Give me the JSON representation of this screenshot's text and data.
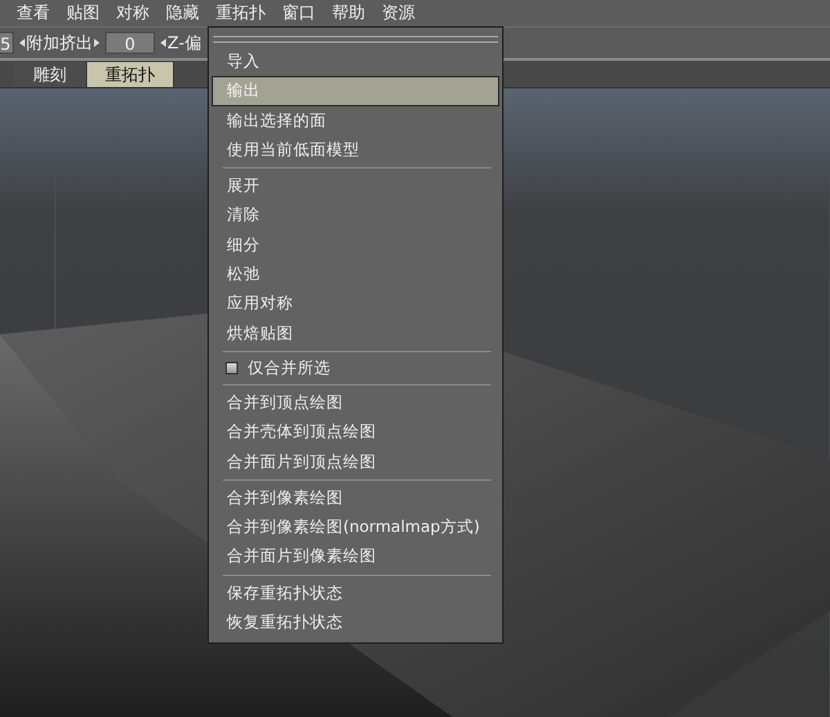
{
  "menu_bar": [
    {
      "label": "查看"
    },
    {
      "label": "贴图"
    },
    {
      "label": "对称"
    },
    {
      "label": "隐藏"
    },
    {
      "label": "重拓扑"
    },
    {
      "label": "窗口"
    },
    {
      "label": "帮助"
    },
    {
      "label": "资源"
    }
  ],
  "toolbar": {
    "field_1": {
      "value": "5"
    },
    "spinner_label": "附加挤出",
    "field_2": {
      "value": "0"
    },
    "spinner_label_2": "Z-偏"
  },
  "tabs": [
    {
      "label": "雕刻",
      "selected": false
    },
    {
      "label": "重拓扑",
      "selected": true
    }
  ],
  "dropdown_menu": {
    "items": [
      {
        "kind": "item",
        "label": "导入",
        "selected": false
      },
      {
        "kind": "item",
        "label": "输出",
        "selected": true
      },
      {
        "kind": "item",
        "label": "输出选择的面",
        "selected": false
      },
      {
        "kind": "item",
        "label": "使用当前低面模型",
        "selected": false
      },
      {
        "kind": "separator"
      },
      {
        "kind": "item",
        "label": "展开",
        "selected": false
      },
      {
        "kind": "item",
        "label": "清除",
        "selected": false
      },
      {
        "kind": "item",
        "label": "细分",
        "selected": false
      },
      {
        "kind": "item",
        "label": "松弛",
        "selected": false
      },
      {
        "kind": "item",
        "label": "应用对称",
        "selected": false
      },
      {
        "kind": "item",
        "label": "烘焙贴图",
        "selected": false
      },
      {
        "kind": "separator"
      },
      {
        "kind": "checkbox",
        "label": "仅合并所选",
        "checked": false
      },
      {
        "kind": "separator"
      },
      {
        "kind": "item",
        "label": "合并到顶点绘图",
        "selected": false
      },
      {
        "kind": "item",
        "label": "合并壳体到顶点绘图",
        "selected": false
      },
      {
        "kind": "item",
        "label": "合并面片到顶点绘图",
        "selected": false
      },
      {
        "kind": "separator"
      },
      {
        "kind": "item",
        "label": "合并到像素绘图",
        "selected": false
      },
      {
        "kind": "item",
        "label": "合并到像素绘图(normalmap方式)",
        "selected": false
      },
      {
        "kind": "item",
        "label": "合并面片到像素绘图",
        "selected": false
      },
      {
        "kind": "separator"
      },
      {
        "kind": "item",
        "label": "保存重拓扑状态",
        "selected": false
      },
      {
        "kind": "item",
        "label": "恢复重拓扑状态",
        "selected": false
      }
    ]
  }
}
